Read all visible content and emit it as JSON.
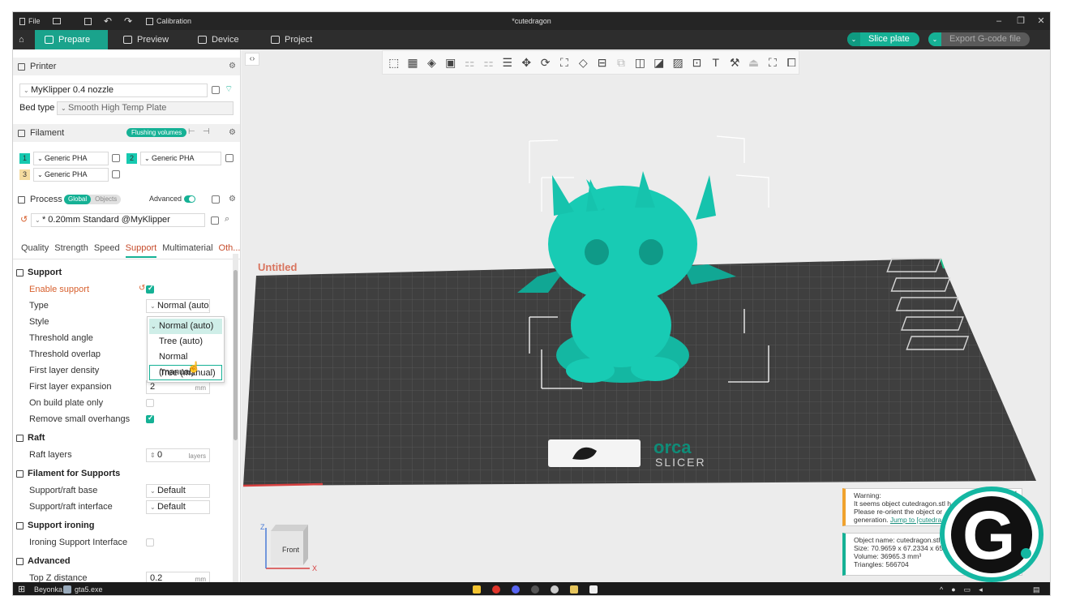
{
  "titlebar": {
    "file_label": "File",
    "calibration_label": "Calibration",
    "document_title": "*cutedragon"
  },
  "tabs": {
    "prepare": "Prepare",
    "preview": "Preview",
    "device": "Device",
    "project": "Project"
  },
  "actions": {
    "slice_plate": "Slice plate",
    "export_gcode": "Export G-code file"
  },
  "printer": {
    "section": "Printer",
    "name": "MyKlipper 0.4 nozzle",
    "bed_type_label": "Bed type",
    "bed_type_value": "Smooth High Temp Plate"
  },
  "filament": {
    "section": "Filament",
    "flushing_badge": "Flushing volumes",
    "slots": [
      {
        "num": "1",
        "name": "Generic PHA",
        "color": "#16c9b0"
      },
      {
        "num": "2",
        "name": "Generic PHA",
        "color": "#16c9b0"
      },
      {
        "num": "3",
        "name": "Generic PHA",
        "color": "#f5dca0"
      }
    ]
  },
  "process": {
    "section": "Process",
    "global": "Global",
    "objects": "Objects",
    "advanced": "Advanced",
    "preset": "* 0.20mm Standard @MyKlipper",
    "subtabs": [
      "Quality",
      "Strength",
      "Speed",
      "Support",
      "Multimaterial",
      "Oth..."
    ],
    "active_subtab": "Support"
  },
  "support": {
    "group": "Support",
    "enable_support": "Enable support",
    "type_label": "Type",
    "type_value": "Normal (auto)",
    "style_label": "Style",
    "threshold_angle": "Threshold angle",
    "threshold_overlap": "Threshold overlap",
    "first_layer_density": "First layer density",
    "first_layer_expansion": "First layer expansion",
    "first_layer_expansion_value": "2",
    "first_layer_expansion_unit": "mm",
    "on_build_plate_only": "On build plate only",
    "remove_small_overhangs": "Remove small overhangs",
    "type_options": [
      "Normal (auto)",
      "Tree (auto)",
      "Normal (manual)",
      "Tree (manual)"
    ]
  },
  "raft": {
    "group": "Raft",
    "raft_layers": "Raft layers",
    "raft_layers_value": "0",
    "raft_layers_unit": "layers"
  },
  "filament_for_supports": {
    "group": "Filament for Supports",
    "base_label": "Support/raft base",
    "base_value": "Default",
    "interface_label": "Support/raft interface",
    "interface_value": "Default"
  },
  "support_ironing": {
    "group": "Support ironing",
    "ironing_interface": "Ironing Support Interface"
  },
  "advanced_group": {
    "group": "Advanced",
    "top_z_distance": "Top Z distance",
    "top_z_value": "0.2",
    "top_z_unit": "mm"
  },
  "viewport": {
    "plate_name": "Untitled",
    "logo_orca": "orca",
    "logo_slicer": "SLICER",
    "cube_front": "Front",
    "axis_x": "X",
    "axis_z": "Z"
  },
  "warning": {
    "title": "Warning:",
    "line1": "It seems object cutedragon.stl h",
    "line2": "Please re-orient the object or",
    "line3_prefix": "generation. ",
    "link": "Jump to [cutedra"
  },
  "object_info": {
    "name": "Object name: cutedragon.stl",
    "size": "Size: 70.9659 x 67.2334 x 65",
    "volume": "Volume: 36965.3 mm³",
    "triangles": "Triangles: 566704"
  },
  "taskbar": {
    "item1": "Beyonka",
    "item2": "gta5.exe"
  },
  "colors": {
    "accent": "#15b195",
    "model": "#18cbb4",
    "modified_label": "#d7602e"
  }
}
